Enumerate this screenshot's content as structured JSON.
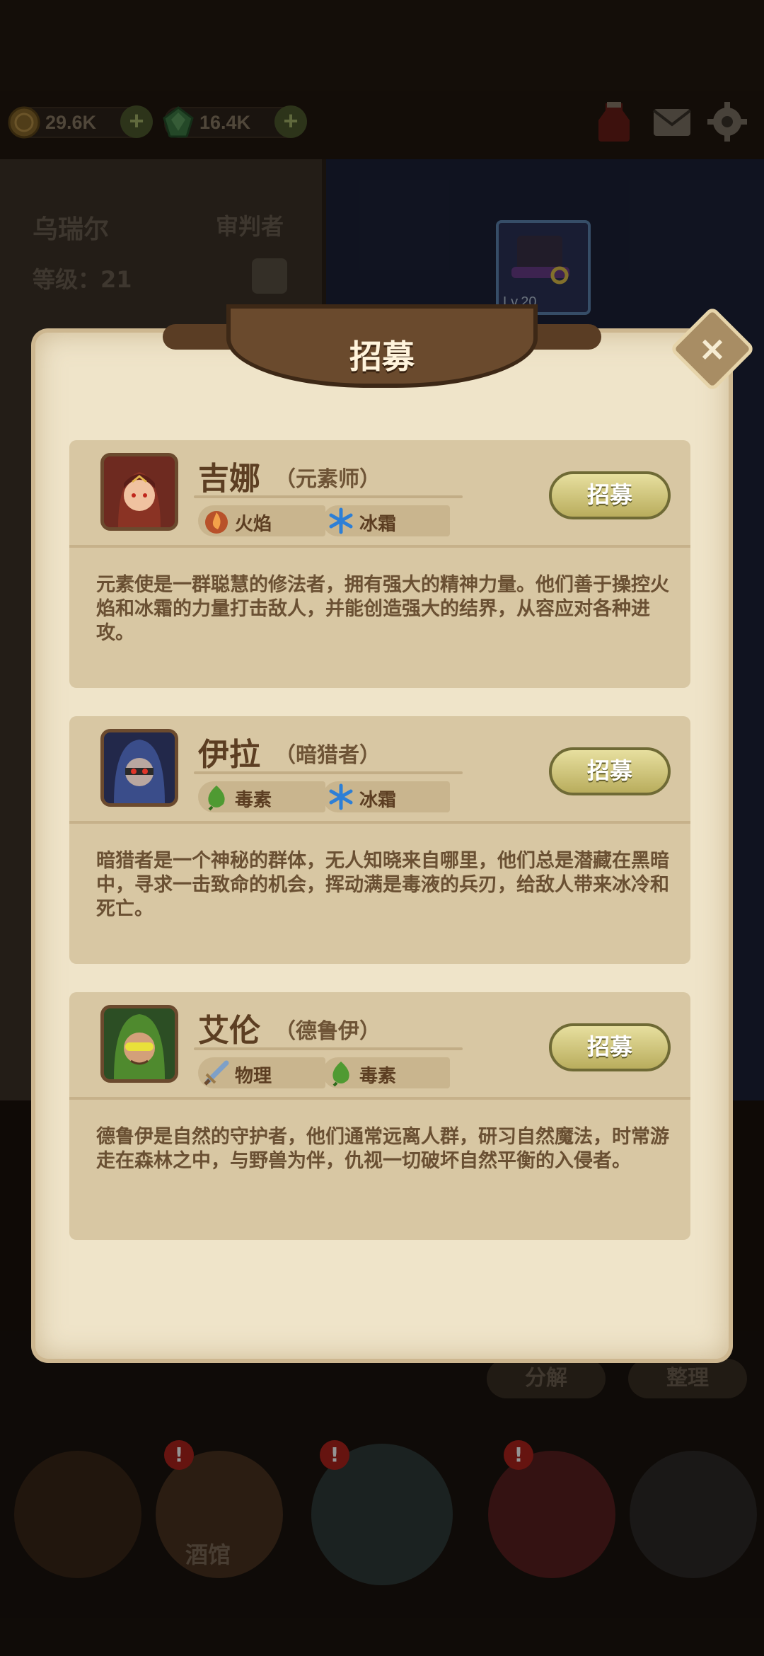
{
  "hud": {
    "gold": "29.6K",
    "gems": "16.4K",
    "plus_symbol": "+"
  },
  "hero_panel": {
    "name": "乌瑞尔",
    "role": "审判者",
    "level_text": "等级：21"
  },
  "equipment": {
    "hat_level": "Lv.20"
  },
  "bottom": {
    "decompose": "分解",
    "organize": "整理",
    "tavern": "酒馆",
    "badge": "!"
  },
  "dialog": {
    "title": "招募",
    "close_symbol": "×",
    "heroes": [
      {
        "name": "吉娜",
        "class": "（元素师）",
        "tags": [
          "火焰",
          "冰霜"
        ],
        "button": "招募",
        "description": "元素使是一群聪慧的修法者，拥有强大的精神力量。他们善于操控火焰和冰霜的力量打击敌人，并能创造强大的结界，从容应对各种进攻。"
      },
      {
        "name": "伊拉",
        "class": "（暗猎者）",
        "tags": [
          "毒素",
          "冰霜"
        ],
        "button": "招募",
        "description": "暗猎者是一个神秘的群体，无人知晓来自哪里，他们总是潜藏在黑暗中，寻求一击致命的机会，挥动满是毒液的兵刃，给敌人带来冰冷和死亡。"
      },
      {
        "name": "艾伦",
        "class": "（德鲁伊）",
        "tags": [
          "物理",
          "毒素"
        ],
        "button": "招募",
        "description": "德鲁伊是自然的守护者，他们通常远离人群，研习自然魔法，时常游走在森林之中，与野兽为伴，仇视一切破坏自然平衡的入侵者。"
      }
    ]
  },
  "colors": {
    "parchment": "#efe4c9",
    "card": "#d8c7a3",
    "recruit_button": "#d6cb80",
    "title_banner": "#6a4a2d"
  }
}
